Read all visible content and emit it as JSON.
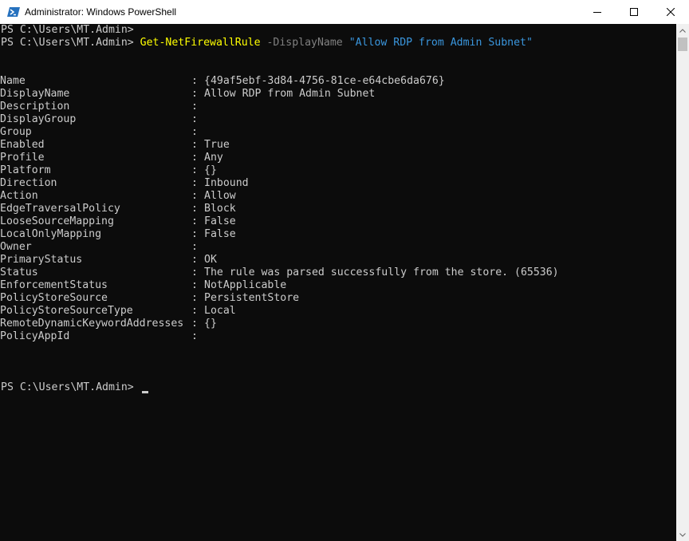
{
  "window": {
    "title": "Administrator: Windows PowerShell"
  },
  "icons": {
    "app": "powershell-icon",
    "minimize": "minimize-icon",
    "maximize": "maximize-icon",
    "close": "close-icon"
  },
  "colors": {
    "background": "#0c0c0c",
    "text": "#cccccc",
    "command": "#ffff00",
    "parameter": "#808080",
    "string": "#3a96dd"
  },
  "console": {
    "prompt1": "PS C:\\Users\\MT.Admin>",
    "prompt2": "PS C:\\Users\\MT.Admin> ",
    "command": "Get-NetFirewallRule",
    "parameter": " -DisplayName ",
    "argument": "\"Allow RDP from Admin Subnet\"",
    "separator": ":",
    "properties": [
      {
        "name": "Name",
        "value": "{49af5ebf-3d84-4756-81ce-e64cbe6da676}"
      },
      {
        "name": "DisplayName",
        "value": "Allow RDP from Admin Subnet"
      },
      {
        "name": "Description",
        "value": ""
      },
      {
        "name": "DisplayGroup",
        "value": ""
      },
      {
        "name": "Group",
        "value": ""
      },
      {
        "name": "Enabled",
        "value": "True"
      },
      {
        "name": "Profile",
        "value": "Any"
      },
      {
        "name": "Platform",
        "value": "{}"
      },
      {
        "name": "Direction",
        "value": "Inbound"
      },
      {
        "name": "Action",
        "value": "Allow"
      },
      {
        "name": "EdgeTraversalPolicy",
        "value": "Block"
      },
      {
        "name": "LooseSourceMapping",
        "value": "False"
      },
      {
        "name": "LocalOnlyMapping",
        "value": "False"
      },
      {
        "name": "Owner",
        "value": ""
      },
      {
        "name": "PrimaryStatus",
        "value": "OK"
      },
      {
        "name": "Status",
        "value": "The rule was parsed successfully from the store. (65536)"
      },
      {
        "name": "EnforcementStatus",
        "value": "NotApplicable"
      },
      {
        "name": "PolicyStoreSource",
        "value": "PersistentStore"
      },
      {
        "name": "PolicyStoreSourceType",
        "value": "Local"
      },
      {
        "name": "RemoteDynamicKeywordAddresses",
        "value": "{}"
      },
      {
        "name": "PolicyAppId",
        "value": ""
      }
    ],
    "prompt3": "PS C:\\Users\\MT.Admin> "
  }
}
